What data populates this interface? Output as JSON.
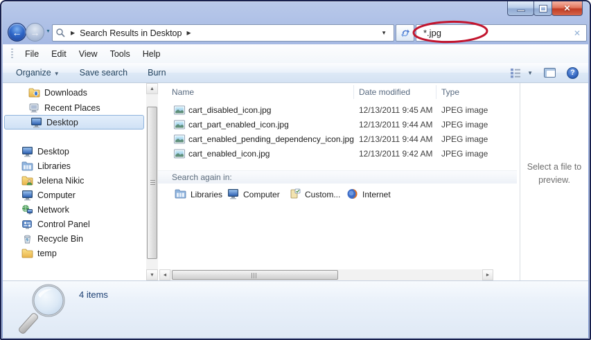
{
  "chrome": {
    "breadcrumb": {
      "location": "Search Results in Desktop"
    },
    "search": {
      "value": "*.jpg"
    }
  },
  "menubar": {
    "items": [
      "File",
      "Edit",
      "View",
      "Tools",
      "Help"
    ]
  },
  "toolbar": {
    "organize": "Organize",
    "save_search": "Save search",
    "burn": "Burn"
  },
  "sidebar": {
    "favorites": [
      {
        "label": "Downloads"
      },
      {
        "label": "Recent Places"
      },
      {
        "label": "Desktop",
        "selected": true
      }
    ],
    "tree": [
      {
        "label": "Desktop"
      },
      {
        "label": "Libraries"
      },
      {
        "label": "Jelena Nikic"
      },
      {
        "label": "Computer"
      },
      {
        "label": "Network"
      },
      {
        "label": "Control Panel"
      },
      {
        "label": "Recycle Bin"
      },
      {
        "label": "temp"
      }
    ]
  },
  "filelist": {
    "columns": {
      "name": "Name",
      "date": "Date modified",
      "type": "Type"
    },
    "rows": [
      {
        "name": "cart_disabled_icon.jpg",
        "date": "12/13/2011 9:45 AM",
        "type": "JPEG image"
      },
      {
        "name": "cart_part_enabled_icon.jpg",
        "date": "12/13/2011 9:44 AM",
        "type": "JPEG image"
      },
      {
        "name": "cart_enabled_pending_dependency_icon.jpg",
        "date": "12/13/2011 9:44 AM",
        "type": "JPEG image"
      },
      {
        "name": "cart_enabled_icon.jpg",
        "date": "12/13/2011 9:42 AM",
        "type": "JPEG image"
      }
    ]
  },
  "search_again": {
    "label": "Search again in:",
    "links": [
      {
        "label": "Libraries"
      },
      {
        "label": "Computer"
      },
      {
        "label": "Custom..."
      },
      {
        "label": "Internet"
      }
    ]
  },
  "preview_pane": {
    "message": "Select a file to preview."
  },
  "statusbar": {
    "items_count": "4 items"
  },
  "icons": {
    "back": "←",
    "forward": "→",
    "nav_dropdown": "▼",
    "crumb_arrow": "▶",
    "crumb_dropdown": "▼",
    "clear": "✕",
    "close": "✕",
    "caret": "▼",
    "scroll_up": "▲",
    "scroll_down": "▼",
    "scroll_left": "◄",
    "scroll_right": "►",
    "help": "?"
  },
  "colors": {
    "annotation_red": "#c2152e",
    "frame_blue": "#8ca3d8",
    "close_red": "#cf4430",
    "selection_blue": "#cfe1f5"
  }
}
